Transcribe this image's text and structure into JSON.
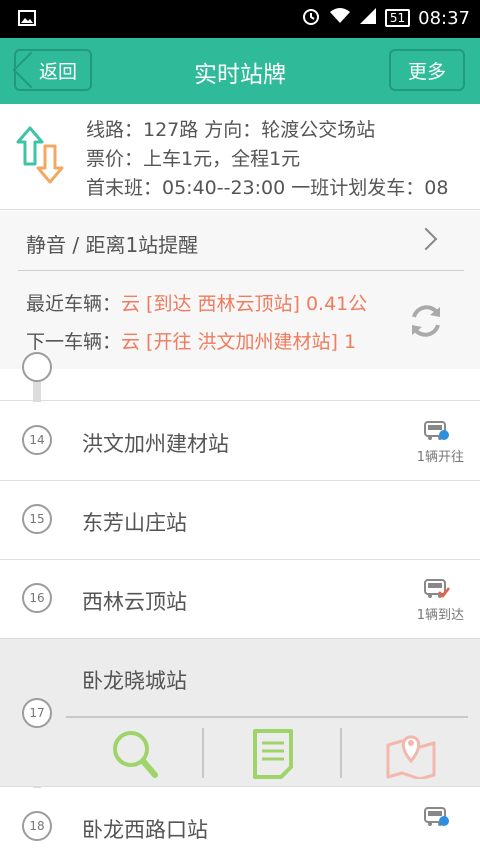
{
  "status_bar": {
    "time": "08:37",
    "battery": "51"
  },
  "header": {
    "back_label": "返回",
    "title": "实时站牌",
    "more_label": "更多"
  },
  "info": {
    "line_text": "线路：127路  方向：轮渡公交场站",
    "fare_text": "票价：上车1元，全程1元",
    "schedule_text": "首末班：05:40--23:00  一班计划发车：08"
  },
  "remind": {
    "label": "静音 / 距离1站提醒"
  },
  "vehicles": {
    "latest_label": "最近车辆：",
    "latest_value": "云 [到达 西林云顶站] 0.41公",
    "next_label": "下一车辆：",
    "next_value": "云 [开往 洪文加州建材站] 1"
  },
  "stations": [
    {
      "num": "14",
      "name": "洪文加州建材站",
      "status": "1辆开往",
      "bus": "bus-arriving-icon"
    },
    {
      "num": "15",
      "name": "东芳山庄站",
      "status": "",
      "bus": ""
    },
    {
      "num": "16",
      "name": "西林云顶站",
      "status": "1辆到达",
      "bus": "bus-arrived-icon"
    },
    {
      "num": "17",
      "name": "卧龙晓城站",
      "status": "",
      "bus": ""
    },
    {
      "num": "18",
      "name": "卧龙西路口站",
      "status": "",
      "bus": "bus-arriving-icon"
    }
  ],
  "actions": [
    "search-icon",
    "document-icon",
    "map-pin-icon"
  ],
  "colors": {
    "accent": "#2fbb99",
    "highlight": "#f07b5e",
    "icon_green": "#9fd46a",
    "icon_pink": "#f4b7ad"
  }
}
